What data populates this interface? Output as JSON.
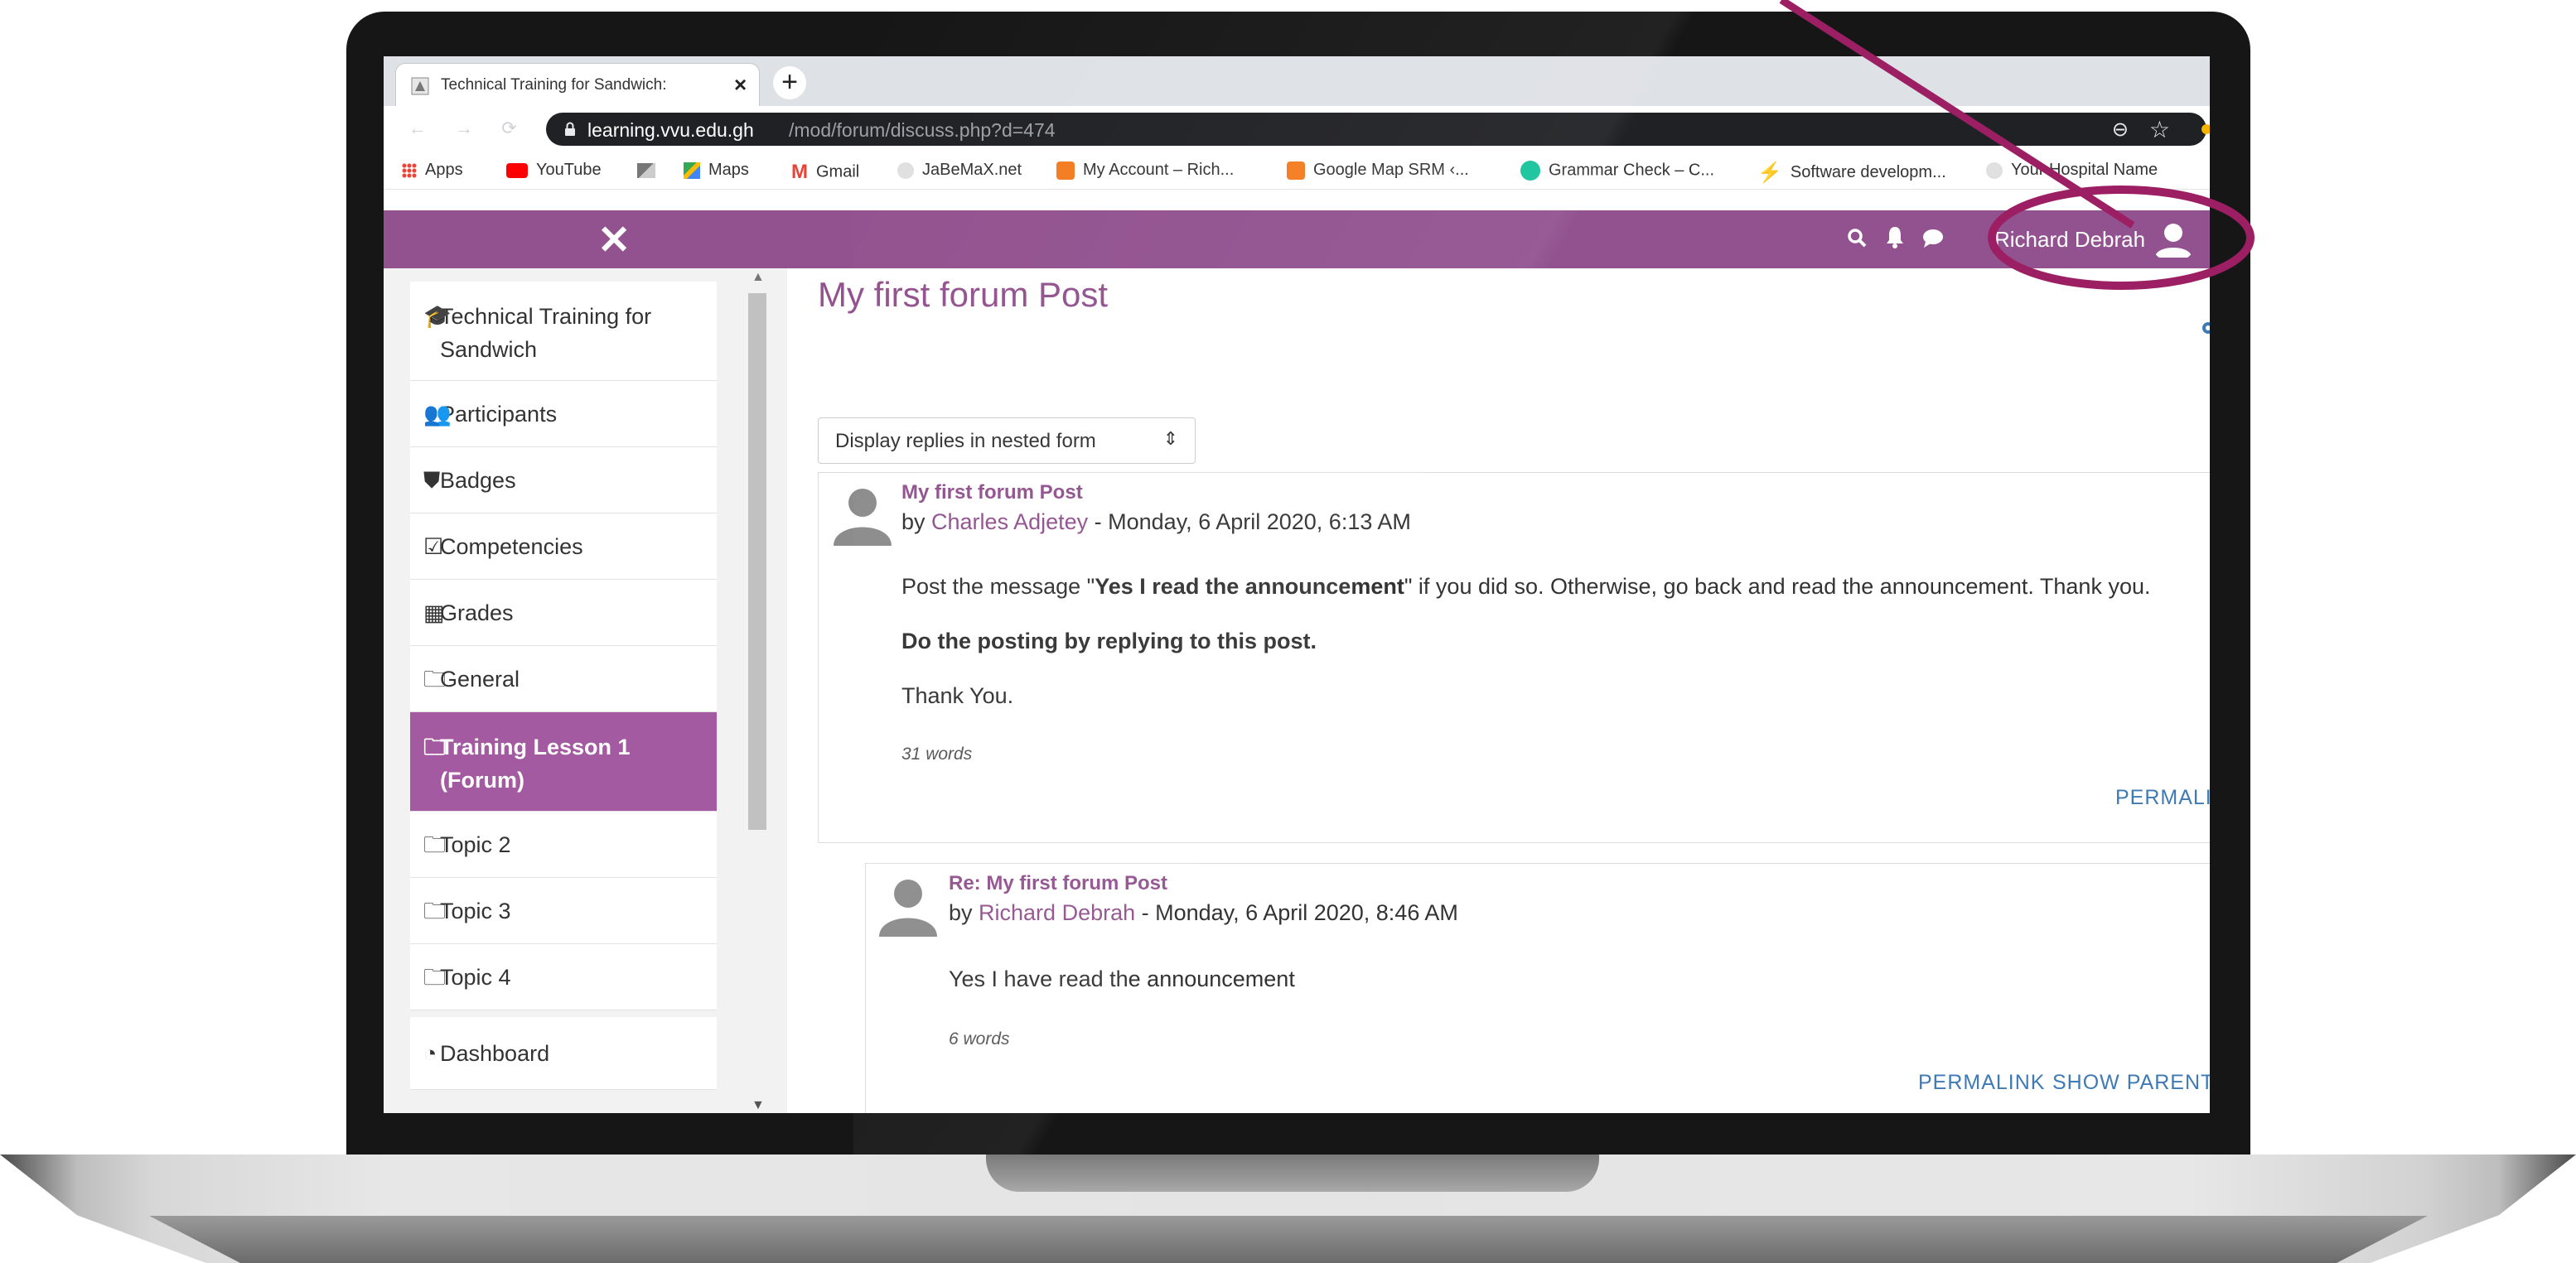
{
  "browser": {
    "tab_title": "Technical Training for Sandwich: ",
    "url_host": "learning.vvu.edu.gh",
    "url_path": "/mod/forum/discuss.php?d=474",
    "bookmarks": [
      {
        "label": "Apps"
      },
      {
        "label": "YouTube"
      },
      {
        "label": ""
      },
      {
        "label": "Maps"
      },
      {
        "label": "Gmail"
      },
      {
        "label": "JaBeMaX.net"
      },
      {
        "label": "My Account – Rich..."
      },
      {
        "label": "Google Map SRM ‹..."
      },
      {
        "label": "Grammar Check – C..."
      },
      {
        "label": "Software developm..."
      },
      {
        "label": "Your Hospital Name"
      }
    ]
  },
  "header": {
    "close_symbol": "✕",
    "user_name": "Richard Debrah",
    "accent_color": "#92528f"
  },
  "sidebar": {
    "items": [
      {
        "label": "Technical Training for Sandwich",
        "icon": "graduation-cap-icon"
      },
      {
        "label": "Participants",
        "icon": "users-icon"
      },
      {
        "label": "Badges",
        "icon": "shield-icon"
      },
      {
        "label": "Competencies",
        "icon": "checkbox-icon"
      },
      {
        "label": "Grades",
        "icon": "table-icon"
      },
      {
        "label": "General",
        "icon": "folder-icon"
      },
      {
        "label": "Training Lesson 1 (Forum)",
        "icon": "folder-icon",
        "active": true
      },
      {
        "label": "Topic 2",
        "icon": "folder-icon"
      },
      {
        "label": "Topic 3",
        "icon": "folder-icon"
      },
      {
        "label": "Topic 4",
        "icon": "folder-icon"
      },
      {
        "label": "Dashboard",
        "icon": "dashboard-icon"
      }
    ]
  },
  "main": {
    "title": "My first forum Post",
    "display_mode": "Display replies in nested form",
    "posts": [
      {
        "subject": "My first forum Post",
        "by": "by ",
        "author": "Charles Adjetey",
        "date": " - Monday, 6 April 2020, 6:13 AM",
        "line1_prefix": "Post the message \"",
        "line1_bold": "Yes I read the announcement",
        "line1_suffix": "\" if you did so. Otherwise, go back and read the announcement. Thank you.",
        "line2_bold": "Do the posting by replying to this post.",
        "line3": "Thank You.",
        "word_count": "31 words",
        "permalink": "PERMALINK"
      },
      {
        "subject": "Re: My first forum Post",
        "by": "by ",
        "author": "Richard Debrah",
        "date": " - Monday, 6 April 2020, 8:46 AM",
        "line1": "Yes I have read the announcement",
        "word_count": "6 words",
        "permalink": "PERMALINK",
        "show_parent": "SHOW PARENT"
      }
    ]
  },
  "annotation_color": "#9c1f63"
}
